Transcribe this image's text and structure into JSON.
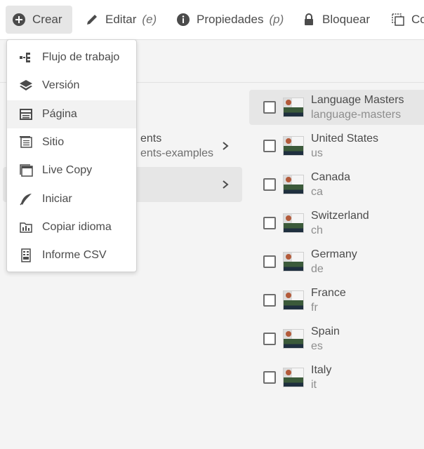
{
  "toolbar": {
    "create": {
      "label": "Crear"
    },
    "edit": {
      "label": "Editar",
      "hint": "(e)"
    },
    "properties": {
      "label": "Propiedades",
      "hint": "(p)"
    },
    "lock": {
      "label": "Bloquear"
    },
    "copy": {
      "label": "Co"
    }
  },
  "menu": {
    "items": [
      {
        "label": "Flujo de trabajo",
        "icon": "workflow-icon"
      },
      {
        "label": "Versión",
        "icon": "layers-icon"
      },
      {
        "label": "Página",
        "icon": "page-icon"
      },
      {
        "label": "Sitio",
        "icon": "site-icon"
      },
      {
        "label": "Live Copy",
        "icon": "live-copy-icon"
      },
      {
        "label": "Iniciar",
        "icon": "launch-icon"
      },
      {
        "label": "Copiar idioma",
        "icon": "language-copy-icon"
      },
      {
        "label": "Informe CSV",
        "icon": "csv-report-icon"
      }
    ]
  },
  "column1": {
    "rows": [
      {
        "title": "ents",
        "subtitle": "ents-examples"
      },
      {
        "title": "",
        "subtitle": ""
      }
    ]
  },
  "column2": {
    "items": [
      {
        "title": "Language Masters",
        "name": "language-masters"
      },
      {
        "title": "United States",
        "name": "us"
      },
      {
        "title": "Canada",
        "name": "ca"
      },
      {
        "title": "Switzerland",
        "name": "ch"
      },
      {
        "title": "Germany",
        "name": "de"
      },
      {
        "title": "France",
        "name": "fr"
      },
      {
        "title": "Spain",
        "name": "es"
      },
      {
        "title": "Italy",
        "name": "it"
      }
    ]
  },
  "colors": {
    "accent": "#4b4b4b",
    "selection": "#e6e6e6",
    "background": "#f4f4f4"
  }
}
